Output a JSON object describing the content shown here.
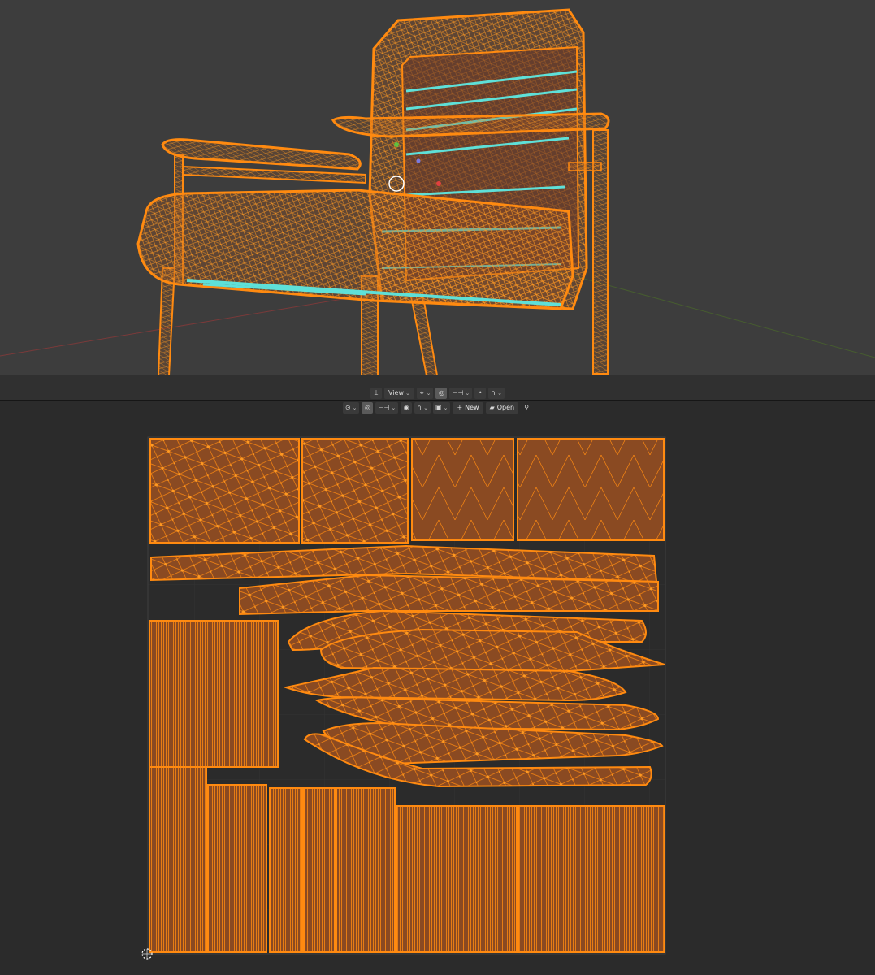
{
  "viewport_3d": {
    "mode": "edit-mode-wireframe",
    "object": "armchair",
    "header": {
      "transform_orientation_icon": "transform-orientation-icon",
      "view_label": "View",
      "pivot_icon": "pivot-icon",
      "snap_icon": "snap-icon",
      "snap_increment_icon": "snap-increment-icon",
      "proportional_icon": "proportional-editing-icon",
      "falloff_icon": "falloff-icon"
    }
  },
  "uv_editor": {
    "header": {
      "pivot_icon": "pivot-icon",
      "snap_icon": "snap-icon",
      "snap_increment_icon": "snap-increment-icon",
      "proportional_icon": "proportional-editing-icon",
      "falloff_icon": "falloff-icon",
      "image_icon": "image-icon",
      "new_label": "New",
      "open_label": "Open",
      "pin_icon": "pin-icon"
    }
  },
  "colors": {
    "viewport_bg": "#3d3d3d",
    "uv_bg": "#2b2b2b",
    "edge_selected": "#ff8a10",
    "face_selected": "#8a4a22",
    "seam": "#5ee0d8",
    "x_axis": "#8a3a3a",
    "y_axis": "#5a7a2a"
  }
}
